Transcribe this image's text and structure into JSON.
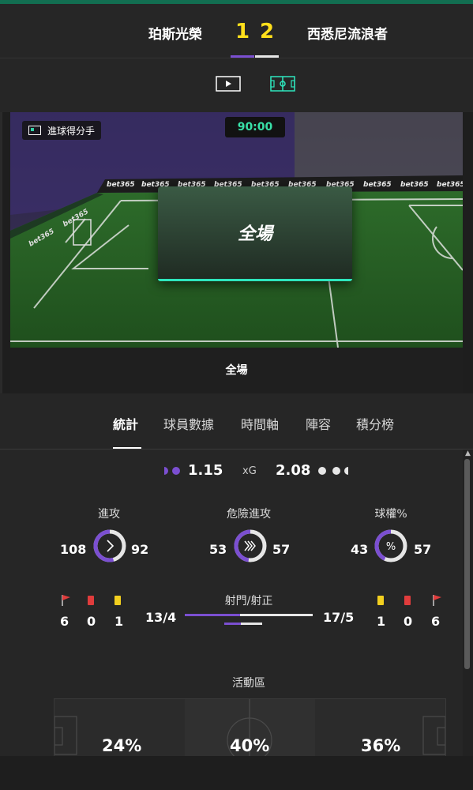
{
  "match": {
    "home_team": "珀斯光榮",
    "away_team": "西悉尼流浪者",
    "home_score": "1",
    "away_score": "2",
    "home_color": "#7b4fd1",
    "away_color": "#e6e6e6"
  },
  "media": {
    "video_icon": "video-play-icon",
    "pitch_icon": "pitch-tracker-icon"
  },
  "live": {
    "event_label": "進球得分手",
    "clock": "90:00",
    "overlay_title": "全場",
    "caption": "全場",
    "board_sponsor": "bet365"
  },
  "tabs": [
    {
      "label": "統計",
      "active": true
    },
    {
      "label": "球員數據",
      "active": false
    },
    {
      "label": "時間軸",
      "active": false
    },
    {
      "label": "陣容",
      "active": false
    },
    {
      "label": "積分榜",
      "active": false
    }
  ],
  "stats": {
    "xg": {
      "label": "xG",
      "home": "1.15",
      "away": "2.08"
    },
    "attacks": {
      "label": "進攻",
      "home": "108",
      "away": "92",
      "home_share": 0.54
    },
    "dangerous": {
      "label": "危險進攻",
      "home": "53",
      "away": "57",
      "home_share": 0.48
    },
    "possession": {
      "label": "球權%",
      "home": "43",
      "away": "57",
      "home_share": 0.43
    },
    "home_discipline": {
      "corners": "6",
      "red": "0",
      "yellow": "1"
    },
    "away_discipline": {
      "yellow": "1",
      "red": "0",
      "corners": "6"
    },
    "shots": {
      "label": "射門/射正",
      "home": "13/4",
      "away": "17/5",
      "home_total_share": 0.43,
      "home_on_target_share": 0.44
    },
    "activity": {
      "label": "活動區",
      "home": "24%",
      "middle": "40%",
      "away": "36%"
    }
  }
}
